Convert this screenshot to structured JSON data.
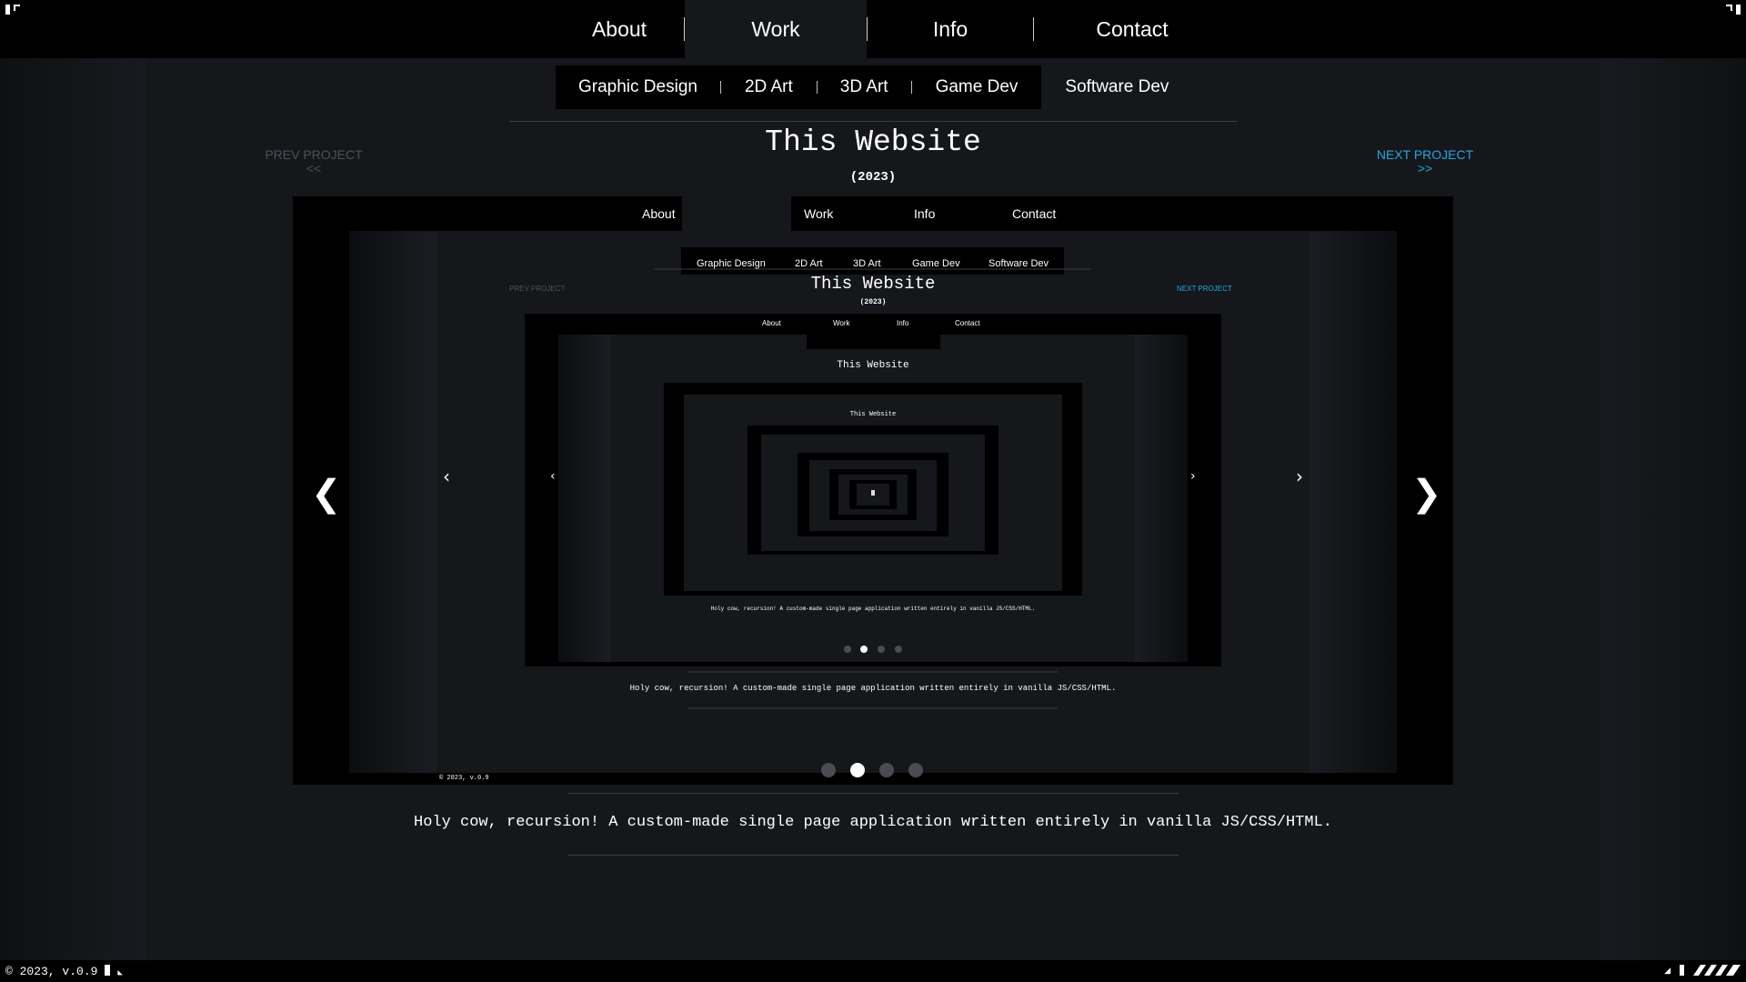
{
  "nav": {
    "items": [
      {
        "label": "About"
      },
      {
        "label": "Work"
      },
      {
        "label": "Info"
      },
      {
        "label": "Contact"
      }
    ],
    "active": "Work"
  },
  "subnav": {
    "items": [
      {
        "label": "Graphic Design"
      },
      {
        "label": "2D Art"
      },
      {
        "label": "3D Art"
      },
      {
        "label": "Game Dev"
      },
      {
        "label": "Software Dev"
      }
    ]
  },
  "project": {
    "title": "This Website",
    "year": "(2023)",
    "prev_label": "PREV PROJECT",
    "prev_arrows": "<<",
    "next_label": "NEXT PROJECT",
    "next_arrows": ">>",
    "caption": "Holy cow, recursion! A custom-made single page application written entirely in vanilla JS/CSS/HTML."
  },
  "gallery": {
    "left_arrow": "❮",
    "right_arrow": "❯",
    "slide_count": 4,
    "active_slide": 2
  },
  "footer": {
    "copyright": "© 2023, v.0.9"
  },
  "colors": {
    "accent": "#22a7e0",
    "background": "#15171b",
    "muted": "#4d5056"
  }
}
